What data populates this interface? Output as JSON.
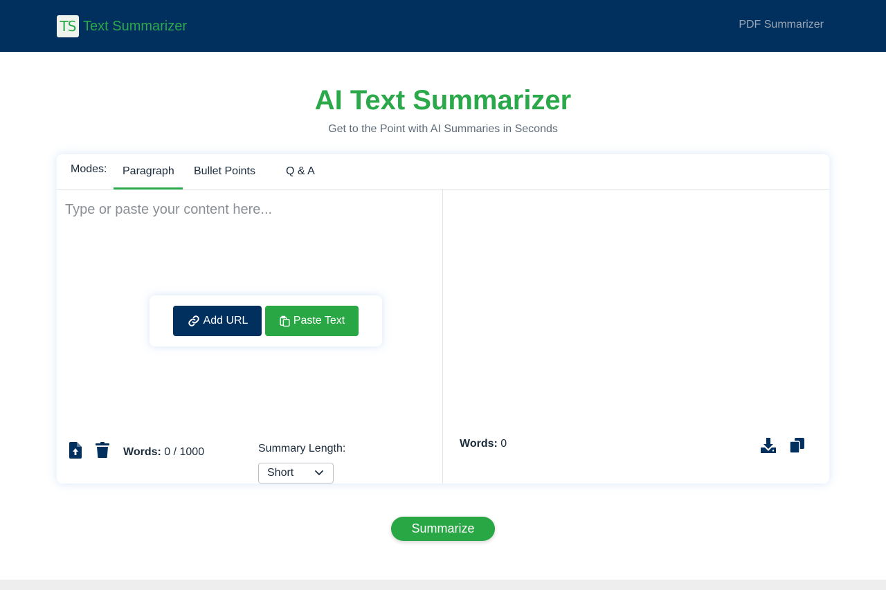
{
  "nav": {
    "logo_text": "TS",
    "brand_name": "Text Summarizer",
    "link_pdf": "PDF Summarizer"
  },
  "hero": {
    "title": "AI Text Summarizer",
    "subtitle": "Get to the Point with AI Summaries in Seconds"
  },
  "modes": {
    "label": "Modes:",
    "tabs": [
      {
        "label": "Paragraph",
        "active": true
      },
      {
        "label": "Bullet Points",
        "active": false
      },
      {
        "label": "Q & A",
        "active": false
      }
    ]
  },
  "input": {
    "placeholder": "Type or paste your content here...",
    "value": ""
  },
  "actions": {
    "add_url": "Add URL",
    "paste_text": "Paste Text"
  },
  "left_footer": {
    "words_label": "Words:",
    "words_value": "0 / 1000",
    "length_label": "Summary Length:",
    "length_selected": "Short"
  },
  "right_footer": {
    "words_label": "Words:",
    "words_value": "0"
  },
  "summarize_label": "Summarize",
  "icons": {
    "upload": "file-upload-icon",
    "trash": "trash-icon",
    "download": "download-icon",
    "copy": "copy-icon",
    "link": "link-icon",
    "clipboard": "clipboard-icon"
  },
  "colors": {
    "navy": "#01305f",
    "green": "#29a745",
    "brand_green": "#2ba84a"
  }
}
